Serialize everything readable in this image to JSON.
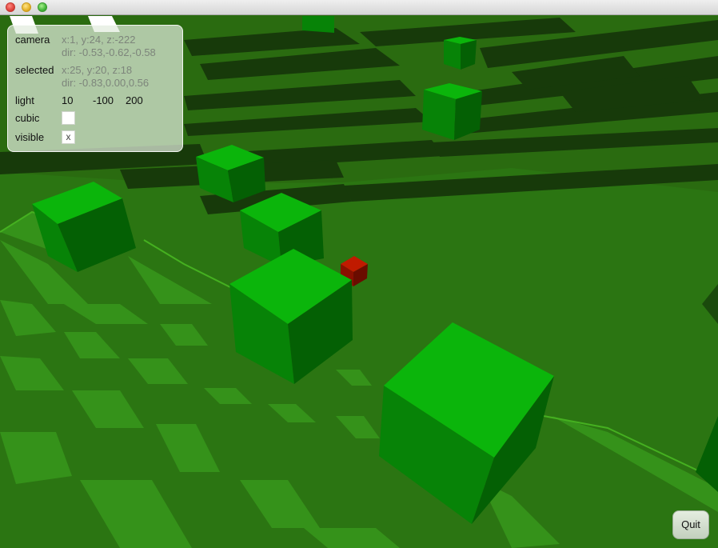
{
  "window": {
    "buttons": [
      "close",
      "minimize",
      "maximize"
    ]
  },
  "panel": {
    "camera": {
      "label": "camera",
      "position": "x:1, y:24, z:-222",
      "direction": "dir: -0.53,-0.62,-0.58"
    },
    "selected": {
      "label": "selected",
      "position": "x:25, y:20, z:18",
      "direction": "dir: -0.83,0.00,0.56"
    },
    "light": {
      "label": "light",
      "x": "10",
      "y": "-100",
      "z": "200"
    },
    "cubic": {
      "label": "cubic",
      "checked": false,
      "mark": ""
    },
    "visible": {
      "label": "visible",
      "checked": true,
      "mark": "x"
    }
  },
  "quit_label": "Quit",
  "colors": {
    "cube_top": "#0bb50b",
    "cube_side": "#078307",
    "cube_dark": "#046004",
    "selected_cube": "#c01a00",
    "terrain_light": "#3aa81a",
    "terrain_mid": "#2b7512",
    "terrain_dark": "#1a3a0c"
  }
}
